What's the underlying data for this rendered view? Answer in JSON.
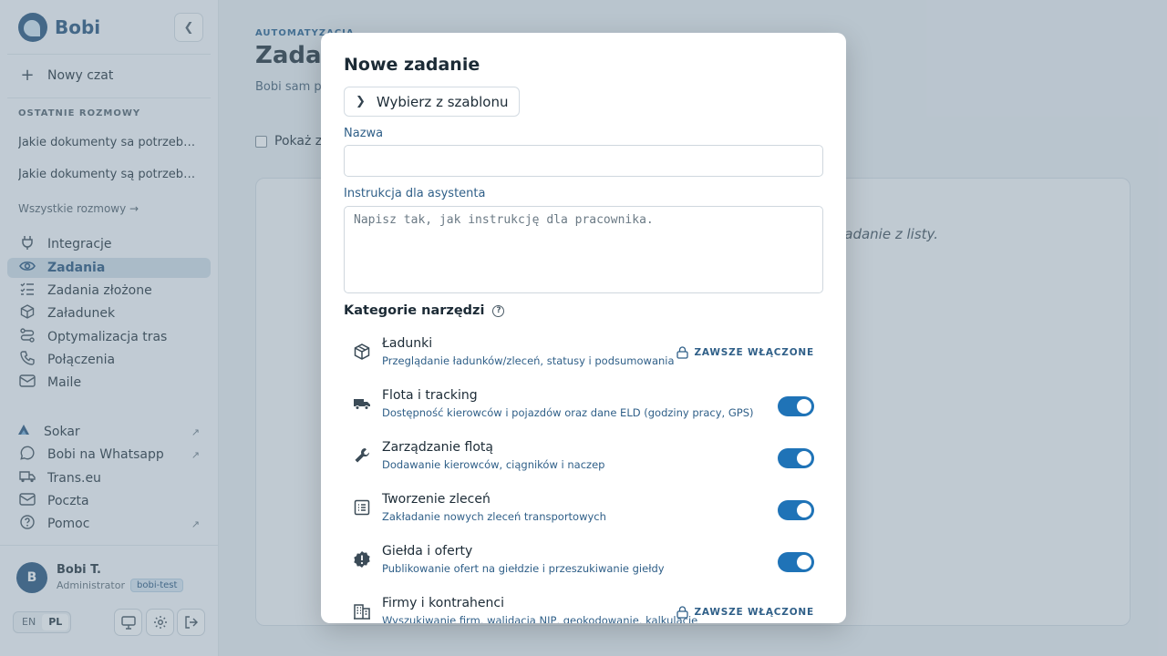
{
  "brand": {
    "name": "Bobi"
  },
  "sidebar": {
    "new_chat": "Nowy czat",
    "recent_label": "OSTATNIE ROZMOWY",
    "recent": [
      "Jakie dokumenty sa potrzebne do przewozu",
      "Jakie dokumenty są potrzebne do przewozu"
    ],
    "all_chats": "Wszystkie rozmowy →",
    "nav": [
      {
        "label": "Integracje",
        "icon": "plug-icon"
      },
      {
        "label": "Zadania",
        "icon": "eye-icon",
        "active": true
      },
      {
        "label": "Zadania złożone",
        "icon": "checklist-icon"
      },
      {
        "label": "Załadunek",
        "icon": "box-icon"
      },
      {
        "label": "Optymalizacja tras",
        "icon": "route-icon"
      },
      {
        "label": "Połączenia",
        "icon": "phone-icon"
      },
      {
        "label": "Maile",
        "icon": "mail-icon"
      }
    ],
    "links": [
      {
        "label": "Sokar",
        "icon": "sokar-icon",
        "external": true
      },
      {
        "label": "Bobi na Whatsapp",
        "icon": "whatsapp-icon",
        "external": true
      },
      {
        "label": "Trans.eu",
        "icon": "truck-icon",
        "external": false
      },
      {
        "label": "Poczta",
        "icon": "mail-icon",
        "external": false
      },
      {
        "label": "Pomoc",
        "icon": "help-icon",
        "external": true
      }
    ],
    "user": {
      "initial": "B",
      "name": "Bobi T.",
      "role": "Administrator",
      "tenant": "bobi-test"
    },
    "lang": {
      "en": "EN",
      "pl": "PL"
    }
  },
  "page": {
    "kicker": "AUTOMATYZACJA",
    "title": "Zadania",
    "desc": "Bobi sam pi informowa",
    "show_label": "Pokaż z",
    "hint": "zadanie z listy."
  },
  "modal": {
    "title": "Nowe zadanie",
    "template_button": "Wybierz z szablonu",
    "name_label": "Nazwa",
    "name_value": "",
    "instruction_label": "Instrukcja dla asystenta",
    "instruction_placeholder": "Napisz tak, jak instrukcję dla pracownika.",
    "categories_title": "Kategorie narzędzi",
    "always_on": "ZAWSZE WŁĄCZONE",
    "categories": [
      {
        "name": "Ładunki",
        "desc": "Przeglądanie ładunków/zleceń, statusy i podsumowania",
        "mode": "always",
        "icon": "package-icon"
      },
      {
        "name": "Flota i tracking",
        "desc": "Dostępność kierowców i pojazdów oraz dane ELD (godziny pracy, GPS)",
        "mode": "toggle",
        "enabled": true,
        "icon": "truck-icon"
      },
      {
        "name": "Zarządzanie flotą",
        "desc": "Dodawanie kierowców, ciągników i naczep",
        "mode": "toggle",
        "enabled": true,
        "icon": "wrench-icon"
      },
      {
        "name": "Tworzenie zleceń",
        "desc": "Zakładanie nowych zleceń transportowych",
        "mode": "toggle",
        "enabled": true,
        "icon": "list-icon"
      },
      {
        "name": "Giełda i oferty",
        "desc": "Publikowanie ofert na giełdzie i przeszukiwanie giełdy",
        "mode": "toggle",
        "enabled": true,
        "icon": "badge-alert-icon"
      },
      {
        "name": "Firmy i kontrahenci",
        "desc": "Wyszukiwanie firm, walidacja NIP, geokodowanie, kalkulacje",
        "mode": "always",
        "icon": "building-icon"
      }
    ]
  }
}
